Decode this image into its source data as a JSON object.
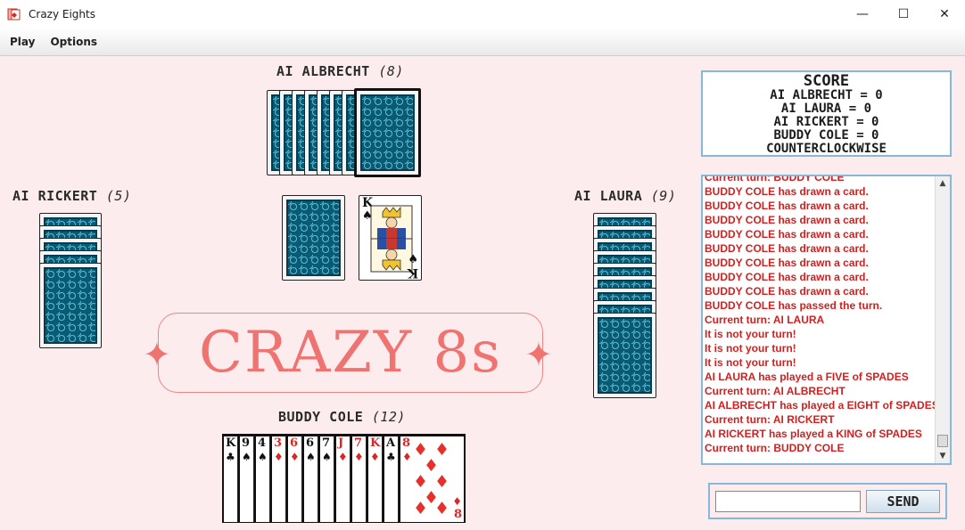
{
  "window": {
    "title": "Crazy Eights",
    "controls": {
      "minimize": "—",
      "maximize": "☐",
      "close": "✕"
    }
  },
  "menu": {
    "items": [
      "Play",
      "Options"
    ]
  },
  "players": {
    "top": {
      "name": "AI ALBRECHT",
      "count": "(8)"
    },
    "left": {
      "name": "AI RICKERT",
      "count": "(5)"
    },
    "right": {
      "name": "AI LAURA",
      "count": "(9)"
    },
    "bottom": {
      "name": "BUDDY COLE",
      "count": "(12)"
    }
  },
  "discard": {
    "rank": "K",
    "suit": "♠",
    "suit_name": "spades"
  },
  "hand": [
    {
      "rank": "K",
      "suit": "♣",
      "color": "black"
    },
    {
      "rank": "9",
      "suit": "♠",
      "color": "black"
    },
    {
      "rank": "4",
      "suit": "♠",
      "color": "black"
    },
    {
      "rank": "3",
      "suit": "♦",
      "color": "red"
    },
    {
      "rank": "6",
      "suit": "♦",
      "color": "red"
    },
    {
      "rank": "6",
      "suit": "♠",
      "color": "black"
    },
    {
      "rank": "7",
      "suit": "♠",
      "color": "black"
    },
    {
      "rank": "J",
      "suit": "♦",
      "color": "red"
    },
    {
      "rank": "7",
      "suit": "♦",
      "color": "red"
    },
    {
      "rank": "K",
      "suit": "♦",
      "color": "red"
    },
    {
      "rank": "A",
      "suit": "♣",
      "color": "black"
    },
    {
      "rank": "8",
      "suit": "♦",
      "color": "red"
    }
  ],
  "logo": {
    "text": "CRAZY 8s"
  },
  "score": {
    "title": "SCORE",
    "lines": [
      "AI ALBRECHT = 0",
      "AI LAURA = 0",
      "AI RICKERT = 0",
      "BUDDY COLE = 0",
      "COUNTERCLOCKWISE"
    ]
  },
  "log": [
    "Current turn: BUDDY COLE",
    "BUDDY COLE has drawn a card.",
    "BUDDY COLE has drawn a card.",
    "BUDDY COLE has drawn a card.",
    "BUDDY COLE has drawn a card.",
    "BUDDY COLE has drawn a card.",
    "BUDDY COLE has drawn a card.",
    "BUDDY COLE has drawn a card.",
    "BUDDY COLE has drawn a card.",
    "BUDDY COLE has passed the turn.",
    "Current turn: AI LAURA",
    "It is not your turn!",
    "It is not your turn!",
    "It is not your turn!",
    "AI LAURA has played a FIVE of SPADES",
    "Current turn: AI ALBRECHT",
    "AI ALBRECHT has played a EIGHT of SPADES",
    "Current turn: AI RICKERT",
    "AI RICKERT has played a KING of SPADES",
    "Current turn: BUDDY COLE"
  ],
  "chat": {
    "input_value": "",
    "send_label": "SEND"
  },
  "colors": {
    "background": "#fdeced",
    "card_back": "#0b5a73",
    "log_text": "#d21f1f",
    "logo": "#ef7370",
    "panel_border": "#86b8dc"
  }
}
